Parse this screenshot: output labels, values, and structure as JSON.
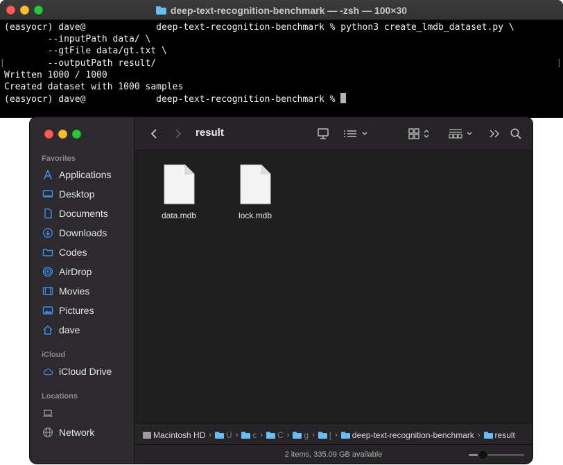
{
  "terminal": {
    "title": "deep-text-recognition-benchmark — -zsh — 100×30",
    "lines": [
      "(easyocr) dave@             deep-text-recognition-benchmark % python3 create_lmdb_dataset.py \\",
      "        --inputPath data/ \\",
      "        --gtFile data/gt.txt \\",
      "        --outputPath result/",
      "Written 1000 / 1000",
      "Created dataset with 1000 samples",
      "(easyocr) dave@             deep-text-recognition-benchmark % "
    ]
  },
  "finder": {
    "title": "result",
    "sidebar": {
      "favorites_label": "Favorites",
      "favorites": [
        {
          "label": "Applications",
          "icon": "applications-icon"
        },
        {
          "label": "Desktop",
          "icon": "desktop-icon"
        },
        {
          "label": "Documents",
          "icon": "document-icon"
        },
        {
          "label": "Downloads",
          "icon": "download-icon"
        },
        {
          "label": "Codes",
          "icon": "folder-icon"
        },
        {
          "label": "AirDrop",
          "icon": "airdrop-icon"
        },
        {
          "label": "Movies",
          "icon": "film-icon"
        },
        {
          "label": "Pictures",
          "icon": "picture-icon"
        },
        {
          "label": "dave",
          "icon": "home-icon"
        }
      ],
      "icloud_label": "iCloud",
      "icloud": [
        {
          "label": "iCloud Drive",
          "icon": "cloud-icon"
        }
      ],
      "locations_label": "Locations",
      "locations": [
        {
          "label": "",
          "icon": "laptop-icon"
        },
        {
          "label": "Network",
          "icon": "network-icon"
        }
      ]
    },
    "files": [
      {
        "name": "data.mdb"
      },
      {
        "name": "lock.mdb"
      }
    ],
    "pathbar": {
      "disk": "Macintosh HD",
      "c1": "U",
      "c2": "c",
      "c3": "C",
      "c4": "g",
      "c5": "[",
      "repo": "deep-text-recognition-benchmark",
      "current": "result"
    },
    "status": "2 items, 335.09 GB available",
    "icon_size": 0.25
  }
}
